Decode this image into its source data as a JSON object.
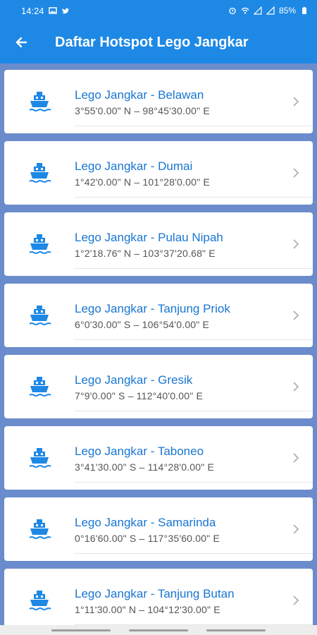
{
  "status": {
    "time": "14:24",
    "battery": "85%",
    "left_icons": [
      "image-icon",
      "twitter-icon"
    ],
    "right_icons": [
      "alarm-icon",
      "wifi-icon",
      "signal-icon",
      "signal-icon",
      "battery-icon"
    ]
  },
  "appbar": {
    "title": "Daftar Hotspot Lego Jangkar",
    "back_icon": "arrow-left-icon",
    "color": "#1e88e5"
  },
  "items": [
    {
      "name": "Lego Jangkar - Belawan",
      "coord": "3°55'0.00\" N – 98°45'30.00\" E"
    },
    {
      "name": "Lego Jangkar - Dumai",
      "coord": "1°42'0.00\" N – 101°28'0.00\" E"
    },
    {
      "name": "Lego Jangkar - Pulau Nipah",
      "coord": "1°2'18.76\" N – 103°37'20.68\" E"
    },
    {
      "name": "Lego Jangkar - Tanjung Priok",
      "coord": "6°0'30.00\" S – 106°54'0.00\" E"
    },
    {
      "name": "Lego Jangkar - Gresik",
      "coord": "7°9'0.00\" S – 112°40'0.00\" E"
    },
    {
      "name": "Lego Jangkar - Taboneo",
      "coord": "3°41'30.00\" S – 114°28'0.00\" E"
    },
    {
      "name": "Lego Jangkar - Samarinda",
      "coord": "0°16'60.00\" S – 117°35'60.00\" E"
    },
    {
      "name": "Lego Jangkar - Tanjung Butan",
      "coord": "1°11'30.00\" N – 104°12'30.00\" E"
    }
  ],
  "item_icon": "ship-icon",
  "accent": "#1976d2",
  "list_background": "#6b8ccc"
}
